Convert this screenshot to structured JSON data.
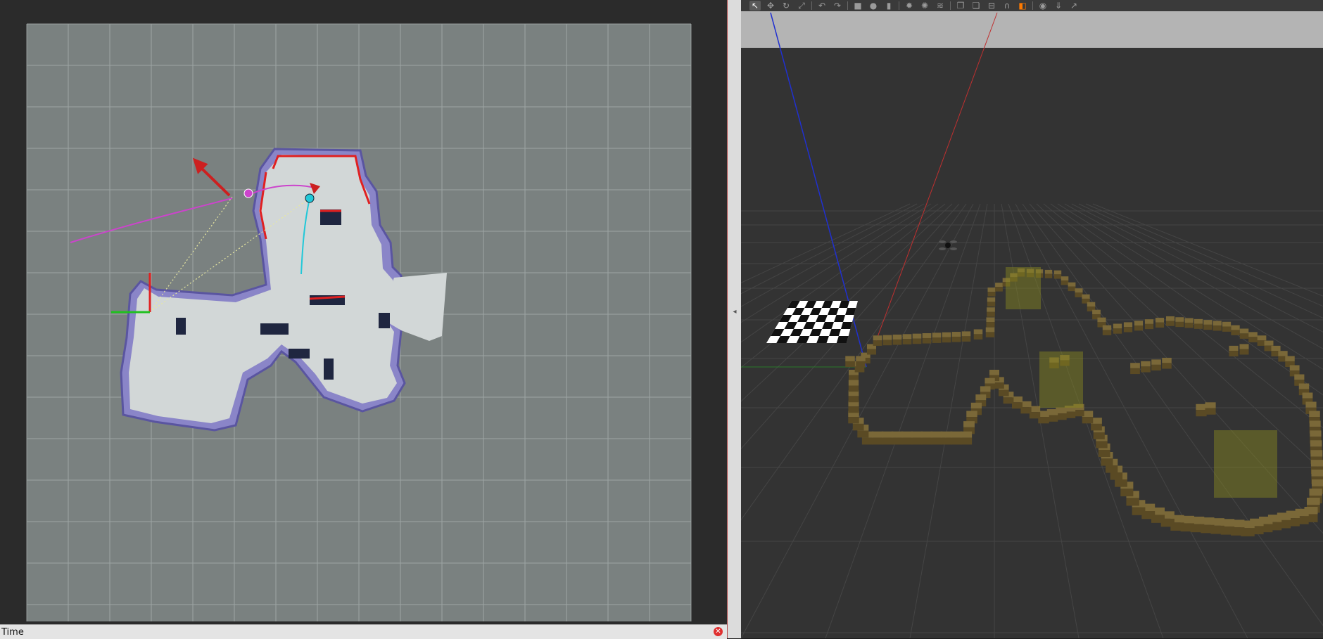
{
  "rviz": {
    "time_panel": {
      "title": "Time"
    }
  },
  "gazebo": {
    "toolbar": [
      {
        "icon": "select-arrow-icon",
        "glyph": "↖",
        "active": true
      },
      {
        "icon": "translate-icon",
        "glyph": "✥"
      },
      {
        "icon": "rotate-icon",
        "glyph": "↻"
      },
      {
        "icon": "scale-icon",
        "glyph": "⤢"
      },
      {
        "sep": true
      },
      {
        "icon": "undo-icon",
        "glyph": "↶"
      },
      {
        "icon": "redo-icon",
        "glyph": "↷"
      },
      {
        "sep": true
      },
      {
        "icon": "box-shape-icon",
        "glyph": "■"
      },
      {
        "icon": "sphere-shape-icon",
        "glyph": "●"
      },
      {
        "icon": "cylinder-shape-icon",
        "glyph": "▮"
      },
      {
        "sep": true
      },
      {
        "icon": "point-light-icon",
        "glyph": "✹"
      },
      {
        "icon": "spot-light-icon",
        "glyph": "✺"
      },
      {
        "icon": "directional-light-icon",
        "glyph": "≋"
      },
      {
        "sep": true
      },
      {
        "icon": "copy-icon",
        "glyph": "❐"
      },
      {
        "icon": "paste-icon",
        "glyph": "❏"
      },
      {
        "icon": "align-icon",
        "glyph": "⊟"
      },
      {
        "icon": "snap-icon",
        "glyph": "∩"
      },
      {
        "icon": "change-view-icon",
        "glyph": "◧",
        "accent": "#ff7a00"
      },
      {
        "sep": true
      },
      {
        "icon": "screenshot-icon",
        "glyph": "◉"
      },
      {
        "icon": "log-icon",
        "glyph": "⇓"
      },
      {
        "icon": "plot-icon",
        "glyph": "↗"
      }
    ]
  },
  "colors": {
    "rviz_background": "#2d2d2d",
    "map_unknown": "#7a8180",
    "map_free": "#d2d7d7",
    "map_inflation": "#8a85c8",
    "path_planned": "#cc44cc",
    "path_trajectory": "#22c8d8",
    "gazebo_wall": "#6b5a30",
    "gazebo_background": "#2e2e2e"
  }
}
